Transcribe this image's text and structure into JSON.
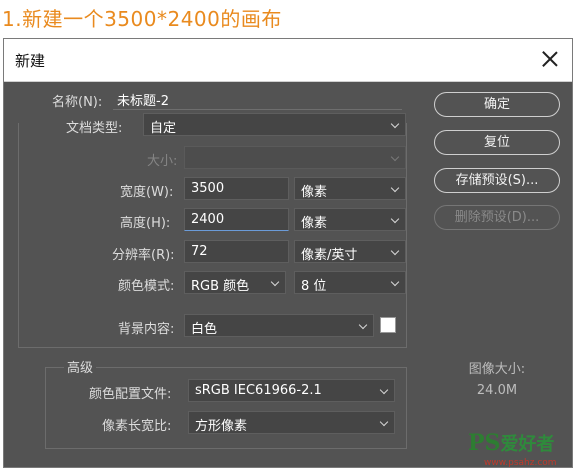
{
  "heading": "1.新建一个3500*2400的画布",
  "dialog": {
    "title": "新建",
    "name_label": "名称(N):",
    "name_value": "未标题-2",
    "doc_type_label": "文档类型:",
    "doc_type_value": "自定",
    "size_label": "大小:",
    "size_value": "",
    "width_label": "宽度(W):",
    "width_value": "3500",
    "width_unit": "像素",
    "height_label": "高度(H):",
    "height_value": "2400",
    "height_unit": "像素",
    "resolution_label": "分辨率(R):",
    "resolution_value": "72",
    "resolution_unit": "像素/英寸",
    "color_mode_label": "颜色模式:",
    "color_mode_value": "RGB 颜色",
    "bit_depth_value": "8 位",
    "background_label": "背景内容:",
    "background_value": "白色",
    "background_swatch_color": "#ffffff",
    "advanced_label": "高级",
    "color_profile_label": "颜色配置文件:",
    "color_profile_value": "sRGB IEC61966-2.1",
    "pixel_aspect_label": "像素长宽比:",
    "pixel_aspect_value": "方形像素",
    "buttons": {
      "ok": "确定",
      "reset": "复位",
      "save_preset": "存储预设(S)...",
      "delete_preset": "删除预设(D)..."
    },
    "image_size_label": "图像大小:",
    "image_size_value": "24.0M"
  },
  "watermark": {
    "text_ps": "PS",
    "text_cn": "爱好者",
    "url": "www.psahz.com"
  },
  "colors": {
    "heading": "#e98a1e",
    "dialog_bg": "#535353",
    "watermark": "#2f8a3c"
  }
}
